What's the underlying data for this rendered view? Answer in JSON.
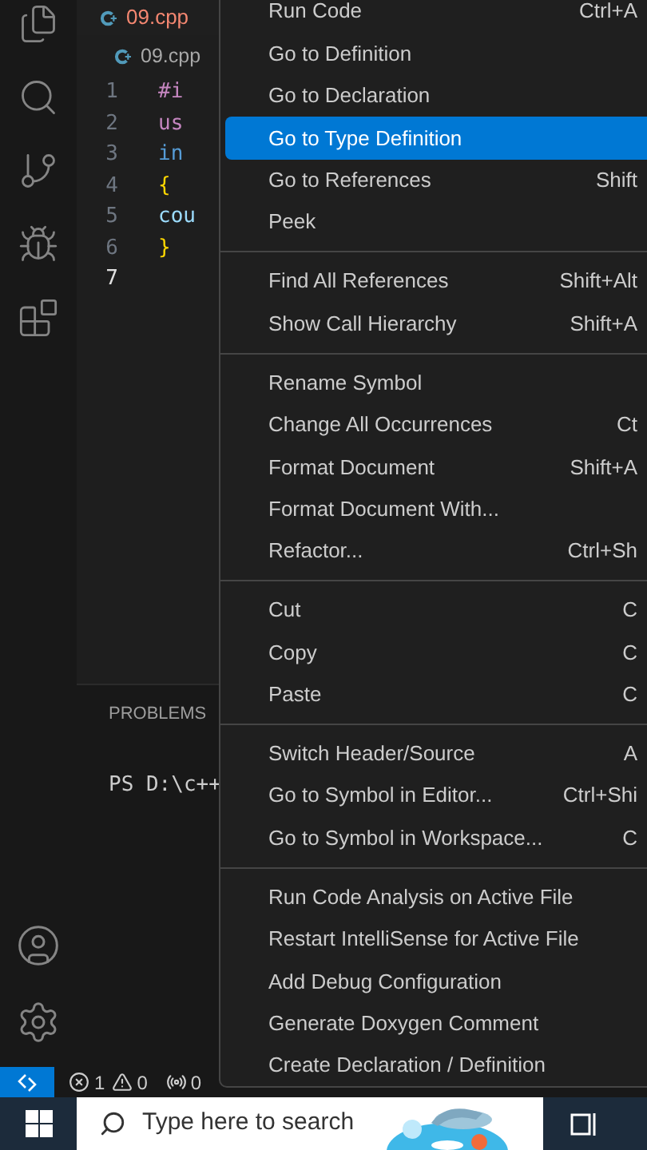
{
  "editor": {
    "tab": {
      "label": "09.cpp"
    },
    "breadcrumb": "09.cpp",
    "lines": [
      {
        "number": "1",
        "code": "#i",
        "kind": "preprocessor",
        "current": false
      },
      {
        "number": "2",
        "code": "us",
        "kind": "keyword",
        "current": false
      },
      {
        "number": "3",
        "code": "in",
        "kind": "type",
        "current": false
      },
      {
        "number": "4",
        "code": "{",
        "kind": "brace",
        "current": false
      },
      {
        "number": "5",
        "code": "cou",
        "kind": "identifier",
        "current": false
      },
      {
        "number": "6",
        "code": "}",
        "kind": "brace",
        "current": false
      },
      {
        "number": "7",
        "current": true
      }
    ]
  },
  "panel": {
    "tab": "PROBLEMS",
    "terminal": "PS D:\\c++"
  },
  "context_menu": {
    "groups": [
      [
        {
          "label": "Run Code",
          "shortcut": "Ctrl+A",
          "selected": false
        },
        {
          "label": "Go to Definition",
          "selected": false
        },
        {
          "label": "Go to Declaration",
          "selected": false
        },
        {
          "label": "Go to Type Definition",
          "selected": true
        },
        {
          "label": "Go to References",
          "shortcut": "Shift",
          "selected": false
        },
        {
          "label": "Peek",
          "selected": false
        }
      ],
      [
        {
          "label": "Find All References",
          "shortcut": "Shift+Alt",
          "selected": false
        },
        {
          "label": "Show Call Hierarchy",
          "shortcut": "Shift+A",
          "selected": false
        }
      ],
      [
        {
          "label": "Rename Symbol",
          "selected": false
        },
        {
          "label": "Change All Occurrences",
          "shortcut": "Ct",
          "selected": false
        },
        {
          "label": "Format Document",
          "shortcut": "Shift+A",
          "selected": false
        },
        {
          "label": "Format Document With...",
          "selected": false
        },
        {
          "label": "Refactor...",
          "shortcut": "Ctrl+Sh",
          "selected": false
        }
      ],
      [
        {
          "label": "Cut",
          "shortcut": "C",
          "selected": false
        },
        {
          "label": "Copy",
          "shortcut": "C",
          "selected": false
        },
        {
          "label": "Paste",
          "shortcut": "C",
          "selected": false
        }
      ],
      [
        {
          "label": "Switch Header/Source",
          "shortcut": "A",
          "selected": false
        },
        {
          "label": "Go to Symbol in Editor...",
          "shortcut": "Ctrl+Shi",
          "selected": false
        },
        {
          "label": "Go to Symbol in Workspace...",
          "shortcut": "C",
          "selected": false
        }
      ],
      [
        {
          "label": "Run Code Analysis on Active File",
          "selected": false
        },
        {
          "label": "Restart IntelliSense for Active File",
          "selected": false
        },
        {
          "label": "Add Debug Configuration",
          "selected": false
        },
        {
          "label": "Generate Doxygen Comment",
          "selected": false
        },
        {
          "label": "Create Declaration / Definition",
          "selected": false
        }
      ]
    ]
  },
  "status_bar": {
    "errors": "1",
    "warnings": "0",
    "ports": "0"
  },
  "taskbar": {
    "search": {
      "placeholder": "Type here to search"
    }
  }
}
